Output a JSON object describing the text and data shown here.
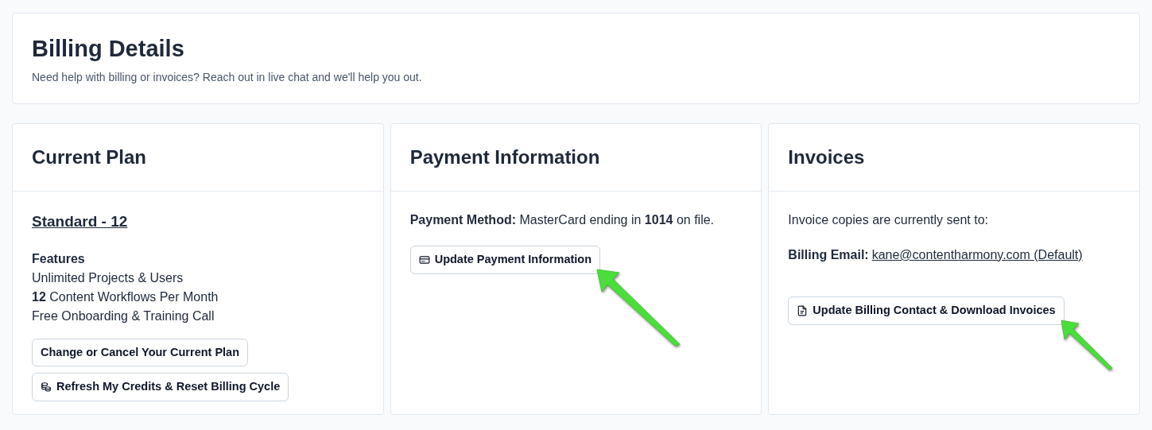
{
  "header": {
    "title": "Billing Details",
    "subtitle": "Need help with billing or invoices? Reach out in live chat and we'll help you out."
  },
  "cards": [
    {
      "title": "Current Plan",
      "blocks": [
        {
          "kind": "plan",
          "text": "Standard - 12"
        },
        {
          "kind": "features",
          "heading": "Features",
          "items": [
            "Unlimited Projects & Users",
            "**12** Content Workflows Per Month",
            "Free Onboarding & Training Call"
          ]
        },
        {
          "kind": "buttons",
          "buttons": [
            {
              "label": "Change or Cancel Your Current Plan",
              "kind": "plain",
              "arrow": false
            },
            {
              "label": "Refresh My Credits & Reset Billing Cycle",
              "kind": "coins",
              "arrow": false
            }
          ]
        }
      ]
    },
    {
      "title": "Payment Information",
      "blocks": [
        {
          "kind": "text",
          "text": "**Payment Method:** MasterCard ending in **1014** on file."
        },
        {
          "kind": "buttons",
          "buttons": [
            {
              "label": "Update Payment Information",
              "kind": "card",
              "arrow": true
            }
          ]
        }
      ]
    },
    {
      "title": "Invoices",
      "blocks": [
        {
          "kind": "text",
          "text": "Invoice copies are currently sent to:"
        },
        {
          "kind": "email",
          "label": "Billing Email:",
          "link": "kane@contentharmony.com (Default)"
        },
        {
          "kind": "buttons",
          "buttons": [
            {
              "label": "Update Billing Contact & Download Invoices",
              "kind": "file",
              "arrow": true
            }
          ]
        }
      ]
    }
  ]
}
